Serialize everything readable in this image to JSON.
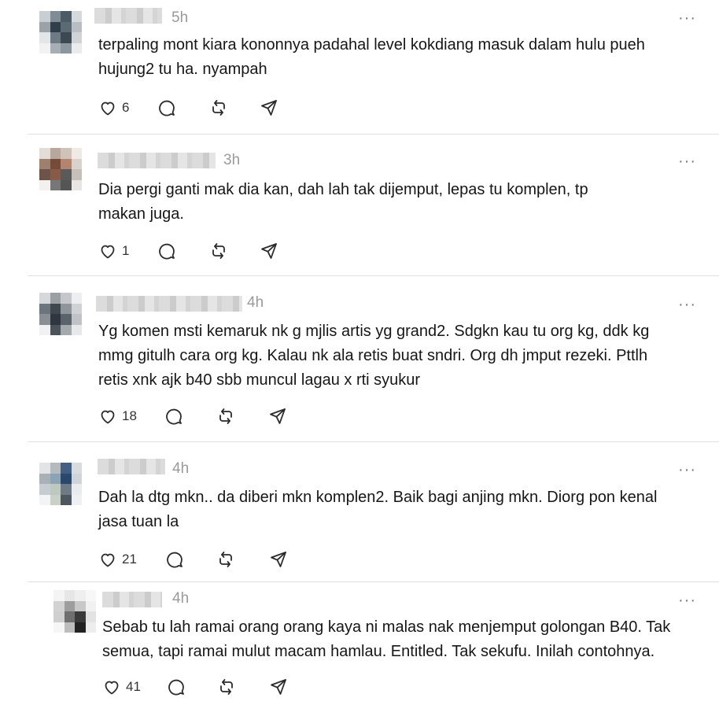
{
  "posts": [
    {
      "time": "5h",
      "text": "terpaling mont kiara kononnya padahal level kokdiang masuk dalam hulu pueh\nhujung2 tu ha. nyampah",
      "likes": "6",
      "avatar_colors": [
        "#c9ced3",
        "#7f8c96",
        "#4b5a66",
        "#d5d9dc",
        "#9aa3aa",
        "#2f3f4c",
        "#5a6b78",
        "#b8bec3",
        "#e3e6e8",
        "#6d7b86",
        "#3b4954",
        "#cfd3d6",
        "#f2f2f2",
        "#a7afb5",
        "#8b969e",
        "#e9ebec"
      ]
    },
    {
      "time": "3h",
      "text": "Dia pergi ganti mak dia kan, dah lah tak dijemput, lepas tu komplen, tp\nmakan juga.",
      "likes": "1",
      "avatar_colors": [
        "#e4ddd8",
        "#b9a79a",
        "#cfc2b8",
        "#efeae6",
        "#a07f6c",
        "#7b4a36",
        "#b8846a",
        "#d9d1cb",
        "#6e5446",
        "#8a5a44",
        "#5a5a5a",
        "#c6beb8",
        "#f3f0ee",
        "#777777",
        "#555555",
        "#e8e5e3"
      ]
    },
    {
      "time": "4h",
      "text": "Yg komen msti kemaruk nk g mjlis artis yg grand2. Sdgkn kau tu org kg, ddk kg\nmmg gitulh cara org kg. Kalau nk ala retis buat sndri. Org dh jmput rezeki. Pttlh\nretis xnk ajk b40 sbb muncul lagau x rti syukur",
      "likes": "18",
      "avatar_colors": [
        "#d6d9dc",
        "#9aa0a6",
        "#c4c8cc",
        "#eceef0",
        "#6a747d",
        "#3e4750",
        "#8e959b",
        "#cfd2d5",
        "#8a8f94",
        "#2e3640",
        "#59626b",
        "#bfc3c7",
        "#f0f1f2",
        "#4b535b",
        "#a3a9ae",
        "#e6e8ea"
      ]
    },
    {
      "time": "4h",
      "text": "Dah la dtg mkn.. da diberi mkn komplen2. Baik bagi anjing mkn. Diorg pon kenal\njasa tuan la",
      "likes": "21",
      "avatar_colors": [
        "#e2e4e6",
        "#b4bac0",
        "#3f5f86",
        "#d8dcdf",
        "#a9b0b6",
        "#8aa2b8",
        "#27486f",
        "#cfd4d8",
        "#c7ccd0",
        "#bcc9bd",
        "#6d7a87",
        "#e9ebed",
        "#f3f4f5",
        "#c9d0c6",
        "#4d5660",
        "#eef0f1"
      ]
    },
    {
      "time": "4h",
      "text": "Sebab tu lah ramai orang orang kaya ni malas nak menjemput golongan B40. Tak\nsemua, tapi ramai mulut macam hamlau. Entitled. Tak sekufu. Inilah contohnya.",
      "likes": "41",
      "avatar_colors": [
        "#f4f4f4",
        "#e6e6e6",
        "#efefef",
        "#f7f7f7",
        "#d2d2d2",
        "#9d9d9d",
        "#c8c8c8",
        "#f1f1f1",
        "#cfcfcf",
        "#6f6f6f",
        "#3a3a3a",
        "#e3e3e3",
        "#f6f6f6",
        "#bdbdbd",
        "#222222",
        "#ededed"
      ]
    }
  ]
}
